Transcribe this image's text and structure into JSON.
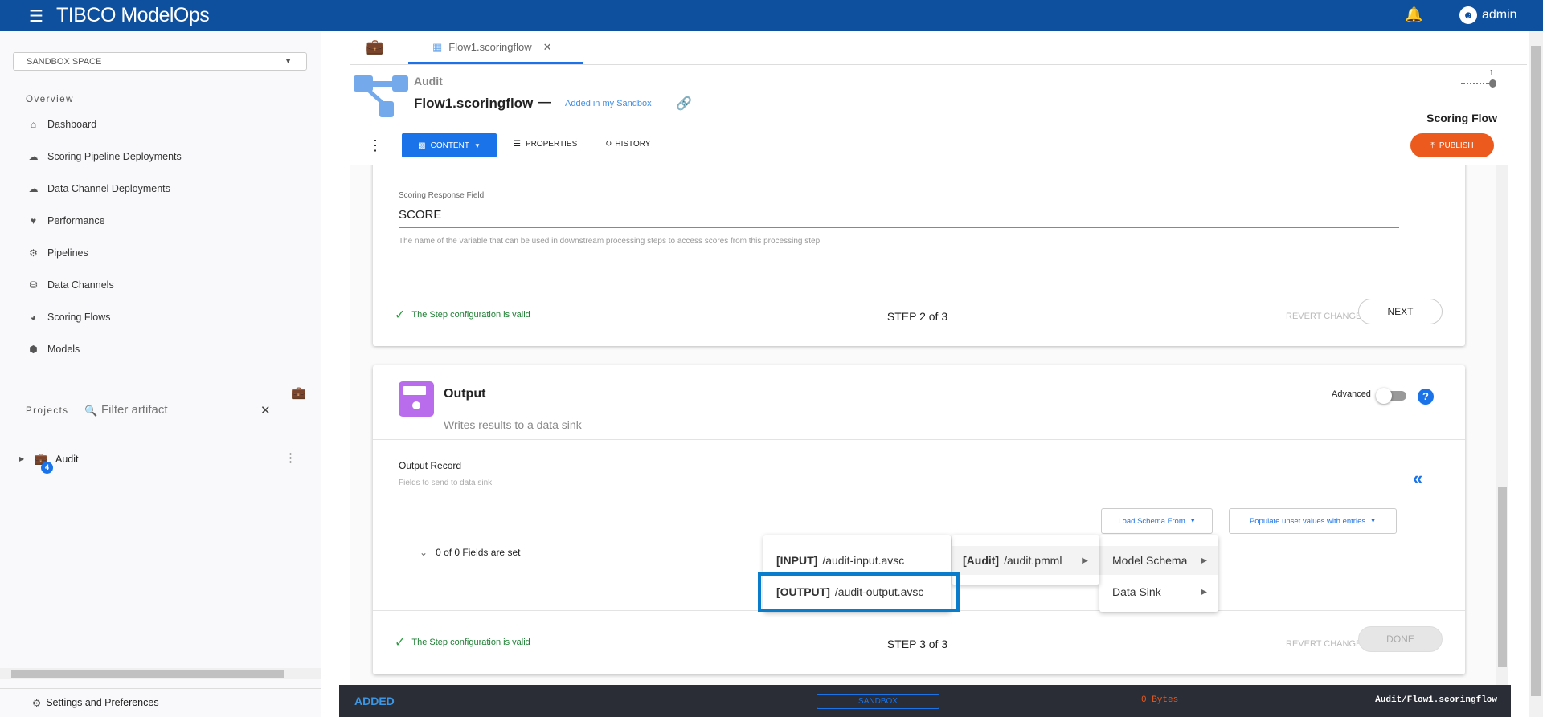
{
  "topbar": {
    "brand": "TIBCO ModelOps",
    "user": "admin"
  },
  "sidebar": {
    "space": "SANDBOX SPACE",
    "overview_label": "Overview",
    "items": [
      {
        "label": "Dashboard"
      },
      {
        "label": "Scoring Pipeline Deployments"
      },
      {
        "label": "Data Channel Deployments"
      },
      {
        "label": "Performance"
      },
      {
        "label": "Pipelines"
      },
      {
        "label": "Data Channels"
      },
      {
        "label": "Scoring Flows"
      },
      {
        "label": "Models"
      }
    ],
    "projects_label": "Projects",
    "filter_placeholder": "Filter artifact",
    "project": {
      "name": "Audit",
      "badge": "4"
    },
    "settings": "Settings and Preferences"
  },
  "tabs": {
    "active": "Flow1.scoringflow"
  },
  "header": {
    "project": "Audit",
    "title": "Flow1.scoringflow",
    "dash": "—",
    "status": "Added in my Sandbox",
    "version": "1",
    "type": "Scoring Flow",
    "content": "CONTENT",
    "properties": "PROPERTIES",
    "history": "HISTORY",
    "publish": "PUBLISH"
  },
  "step2": {
    "field_label": "Scoring Response Field",
    "field_value": "SCORE",
    "help": "The name of the variable that can be used in downstream processing steps to access scores from this processing step.",
    "valid": "The Step configuration is valid",
    "step": "STEP 2 of 3",
    "revert": "REVERT CHANGES",
    "next": "NEXT"
  },
  "step3": {
    "title": "Output",
    "desc": "Writes results to a data sink",
    "advanced": "Advanced",
    "record_label": "Output Record",
    "record_help": "Fields to send to data sink.",
    "load_schema": "Load Schema From",
    "populate": "Populate unset values with entries",
    "fields_set": "0 of 0 Fields are set",
    "valid": "The Step configuration is valid",
    "step": "STEP 3 of 3",
    "revert": "REVERT CHANGES",
    "done": "DONE"
  },
  "menus": {
    "sources": [
      {
        "label": "Model Schema"
      },
      {
        "label": "Data Sink"
      }
    ],
    "model": {
      "tag": "[Audit]",
      "path": "/audit.pmml"
    },
    "files": [
      {
        "tag": "[INPUT]",
        "path": "/audit-input.avsc"
      },
      {
        "tag": "[OUTPUT]",
        "path": "/audit-output.avsc"
      }
    ]
  },
  "statusbar": {
    "state": "ADDED",
    "space": "SANDBOX",
    "size": "0 Bytes",
    "path": "Audit/Flow1.scoringflow"
  },
  "colors": {
    "brand": "#0f509e",
    "accent": "#1a73e8",
    "publish": "#ec5a1e",
    "highlight": "#0a7ccc"
  }
}
